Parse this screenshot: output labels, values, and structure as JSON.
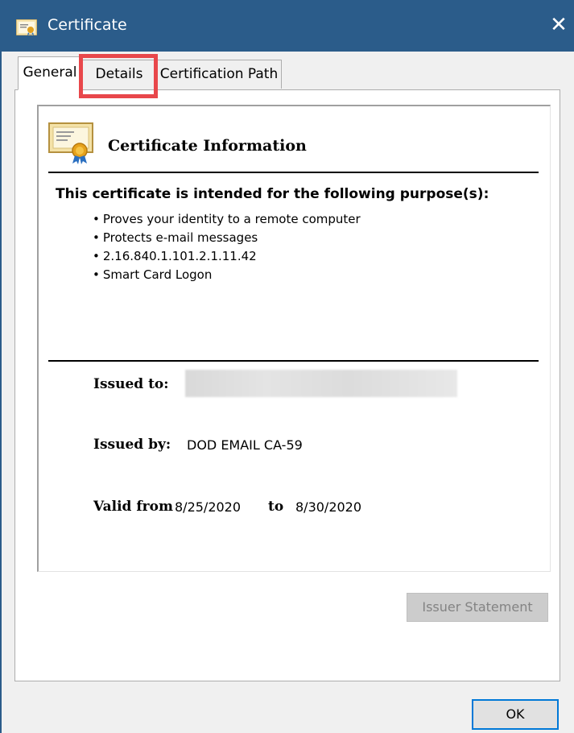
{
  "window": {
    "title": "Certificate",
    "close_glyph": "✕"
  },
  "tabs": [
    {
      "label": "General",
      "selected": true
    },
    {
      "label": "Details",
      "selected": false
    },
    {
      "label": "Certification Path",
      "selected": false
    }
  ],
  "info": {
    "heading": "Certificate Information",
    "purpose_heading": "This certificate is intended for the following purpose(s):",
    "purposes": [
      "Proves your identity to a remote computer",
      "Protects e-mail messages",
      "2.16.840.1.101.2.1.11.42",
      "Smart Card Logon"
    ],
    "issued_to_label": "Issued to:",
    "issued_to_value": "",
    "issued_by_label": "Issued by:",
    "issued_by_value": "DOD EMAIL CA-59",
    "valid_from_label": "Valid from",
    "valid_from_value": "8/25/2020",
    "valid_to_label": "to",
    "valid_to_value": "8/30/2020"
  },
  "buttons": {
    "issuer_statement": "Issuer Statement",
    "ok": "OK"
  },
  "icons": {
    "title": "certificate-icon",
    "info": "certificate-ribbon-icon"
  },
  "colors": {
    "titlebar": "#2b5c8a",
    "highlight": "#e8474b",
    "focus": "#0078d7"
  }
}
